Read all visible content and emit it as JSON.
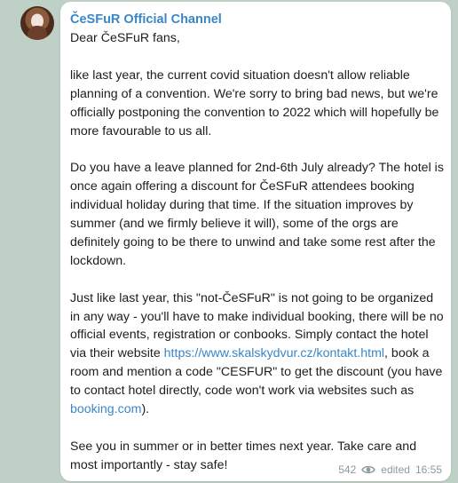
{
  "avatar": {
    "icon": "channel-avatar-icon"
  },
  "channel": {
    "name": "ČeSFuR Official Channel"
  },
  "message": {
    "greeting": "Dear ČeSFuR fans,",
    "paragraph1": "like last year, the current covid situation doesn't allow reliable planning of a convention. We're sorry to bring bad news, but we're officially postponing the convention to 2022 which will hopefully be more favourable to us all.",
    "paragraph2": "Do you have a leave planned for 2nd-6th July already? The hotel is once again offering a discount for ČeSFuR attendees booking individual holiday during that time. If the situation improves by summer (and we firmly believe it will), some of the orgs are definitely going to be there to unwind and take some rest after the lockdown.",
    "paragraph3_before_link": "Just like last year, this \"not-ČeSFuR\" is not going to be organized in any way - you'll have to make individual booking, there will be no official events, registration or conbooks. Simply contact the hotel via their website ",
    "link1": "https://www.skalskydvur.cz/kontakt.html",
    "paragraph3_middle": ", book a room and mention a code \"CESFUR\" to get the discount (you have to contact hotel directly, code won't work via websites such as ",
    "link2": "booking.com",
    "paragraph3_end": ").",
    "paragraph4": "See you in summer or in better times next year. Take care and most importantly - stay safe!"
  },
  "meta": {
    "views": "542",
    "views_icon": "eye-icon",
    "status": "edited",
    "time": "16:55"
  },
  "colors": {
    "background": "#bfd1c7",
    "bubble": "#ffffff",
    "accent": "#3a86c8",
    "meta_text": "#8c9aa3"
  }
}
